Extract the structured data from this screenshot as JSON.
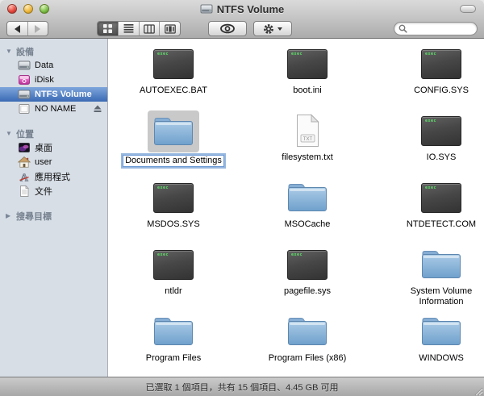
{
  "window": {
    "title": "NTFS Volume"
  },
  "titlebar": {
    "buttons": [
      "close",
      "minimize",
      "zoom"
    ],
    "title_icon": "volume-icon"
  },
  "toolbar": {
    "icons": [
      "back",
      "forward",
      "icon-view",
      "list-view",
      "column-view",
      "coverflow-view",
      "quick-look-eye",
      "action-gear",
      "search"
    ],
    "selected_view": "icon-view",
    "search": {
      "value": ""
    }
  },
  "sidebar": {
    "sections": [
      {
        "label": "設備",
        "expanded": true,
        "items": [
          {
            "label": "Data",
            "icon": "hard-drive",
            "selected": false
          },
          {
            "label": "iDisk",
            "icon": "idisk",
            "selected": false
          },
          {
            "label": "NTFS Volume",
            "icon": "hard-drive",
            "selected": true
          },
          {
            "label": "NO NAME",
            "icon": "removable-drive",
            "selected": false,
            "ejectable": true
          }
        ]
      },
      {
        "label": "位置",
        "expanded": true,
        "items": [
          {
            "label": "桌面",
            "icon": "desktop",
            "selected": false
          },
          {
            "label": "user",
            "icon": "home",
            "selected": false
          },
          {
            "label": "應用程式",
            "icon": "applications",
            "selected": false
          },
          {
            "label": "文件",
            "icon": "documents",
            "selected": false
          }
        ]
      },
      {
        "label": "搜尋目標",
        "expanded": false,
        "items": []
      }
    ]
  },
  "files": [
    {
      "name": "AUTOEXEC.BAT",
      "type": "exec"
    },
    {
      "name": "boot.ini",
      "type": "exec"
    },
    {
      "name": "CONFIG.SYS",
      "type": "exec"
    },
    {
      "name": "Documents and Settings",
      "type": "folder",
      "selected": true,
      "renaming": true
    },
    {
      "name": "filesystem.txt",
      "type": "txt"
    },
    {
      "name": "IO.SYS",
      "type": "exec"
    },
    {
      "name": "MSDOS.SYS",
      "type": "exec"
    },
    {
      "name": "MSOCache",
      "type": "folder"
    },
    {
      "name": "NTDETECT.COM",
      "type": "exec"
    },
    {
      "name": "ntldr",
      "type": "exec"
    },
    {
      "name": "pagefile.sys",
      "type": "exec"
    },
    {
      "name": "System Volume Information",
      "type": "folder"
    },
    {
      "name": "Program Files",
      "type": "folder"
    },
    {
      "name": "Program Files (x86)",
      "type": "folder"
    },
    {
      "name": "WINDOWS",
      "type": "folder"
    }
  ],
  "icon_labels": {
    "exec": "exec",
    "txt": "TXT"
  },
  "status_bar": {
    "text": "已選取 1 個項目，共有 15 個項目、4.45 GB 可用"
  },
  "colors": {
    "sidebar_bg": "#D7DEE6",
    "selection_blue_top": "#7FA6DC",
    "selection_blue_bottom": "#3A6AB4",
    "folder_blue": "#86AED4",
    "exec_green": "#5CE268",
    "icon_selection_gray": "#C9C9C9"
  }
}
